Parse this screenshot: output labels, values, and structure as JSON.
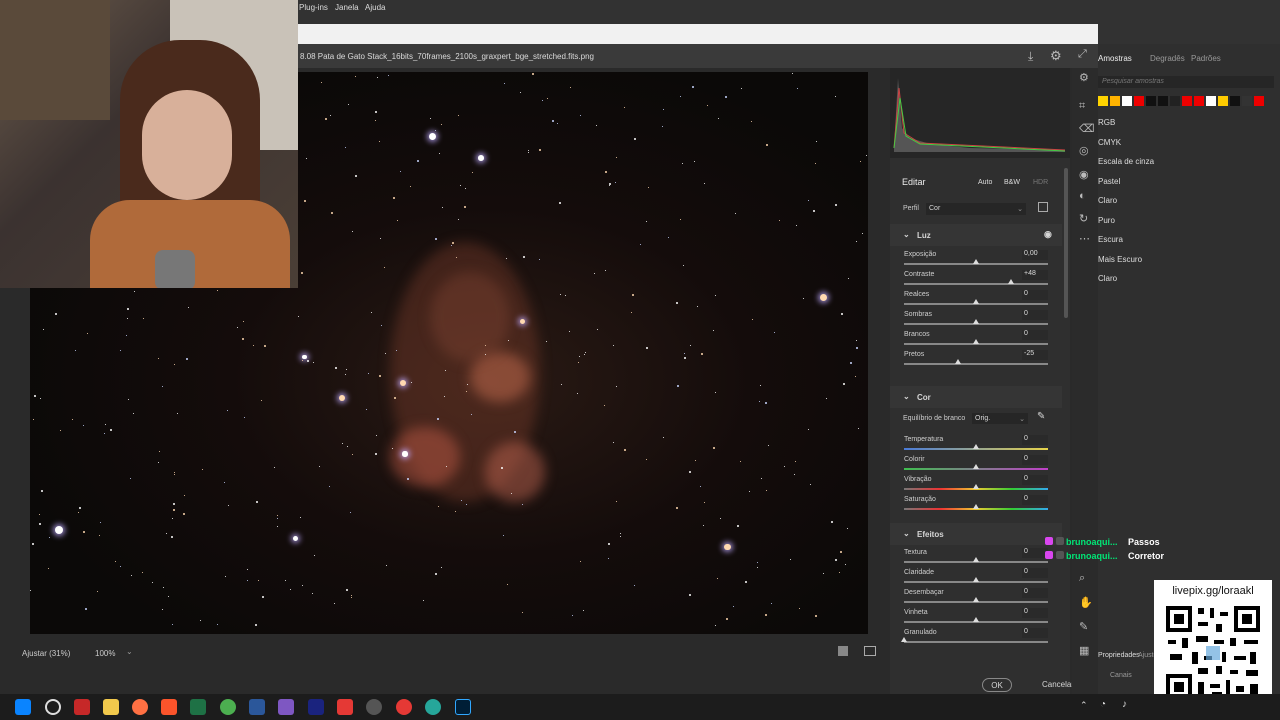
{
  "menubar": {
    "items": [
      "Plug-ins",
      "Janela",
      "Ajuda"
    ]
  },
  "document": {
    "title": "8.08 Pata de Gato Stack_16bits_70frames_2100s_graxpert_bge_stretched.fits.png"
  },
  "preview_footer": {
    "zoom_fit": "Ajustar (31%)",
    "zoom": "100%"
  },
  "panel": {
    "edit_label": "Editar",
    "auto": "Auto",
    "bw": "B&W",
    "hdr": "HDR",
    "profile_label": "Perfil",
    "profile_value": "Cor",
    "sections": {
      "light": {
        "title": "Luz",
        "sliders": [
          {
            "label": "Exposição",
            "value": "0,00",
            "pos": 0.5
          },
          {
            "label": "Contraste",
            "value": "+48",
            "pos": 0.74
          },
          {
            "label": "Realces",
            "value": "0",
            "pos": 0.5
          },
          {
            "label": "Sombras",
            "value": "0",
            "pos": 0.5
          },
          {
            "label": "Brancos",
            "value": "0",
            "pos": 0.5
          },
          {
            "label": "Pretos",
            "value": "-25",
            "pos": 0.375
          }
        ]
      },
      "color": {
        "title": "Cor",
        "wb_label": "Equilíbrio de branco",
        "wb_value": "Orig.",
        "sliders": [
          {
            "label": "Temperatura",
            "value": "0",
            "pos": 0.5
          },
          {
            "label": "Colorir",
            "value": "0",
            "pos": 0.5
          },
          {
            "label": "Vibração",
            "value": "0",
            "pos": 0.5
          },
          {
            "label": "Saturação",
            "value": "0",
            "pos": 0.5
          }
        ]
      },
      "effects": {
        "title": "Efeitos",
        "sliders": [
          {
            "label": "Textura",
            "value": "0",
            "pos": 0.5
          },
          {
            "label": "Claridade",
            "value": "0",
            "pos": 0.5
          },
          {
            "label": "Desembaçar",
            "value": "0",
            "pos": 0.5
          },
          {
            "label": "Vinheta",
            "value": "0",
            "pos": 0.5
          },
          {
            "label": "Granulado",
            "value": "0",
            "pos": 0.0
          }
        ]
      }
    },
    "ok": "OK",
    "cancel": "Cancelar"
  },
  "right_ps": {
    "tabs": [
      "Amostras",
      "Degradês",
      "Padrões"
    ],
    "search_placeholder": "Pesquisar amostras",
    "swatch_groups": [
      "RGB",
      "CMYK",
      "Escala de cinza",
      "Pastel",
      "Claro",
      "Puro",
      "Escura",
      "Mais Escuro",
      "Claro"
    ],
    "bottom_tabs": [
      "Propriedades",
      "Ajustes"
    ],
    "channels": "Canais"
  },
  "chat": [
    {
      "user": "brunoaqui...",
      "msg": "Passos"
    },
    {
      "user": "brunoaqui...",
      "msg": "Corretor"
    }
  ],
  "qr": {
    "label": "livepix.gg/loraakl"
  },
  "colors": {
    "accent": "#1473e6",
    "chat_user": "#00e676"
  }
}
